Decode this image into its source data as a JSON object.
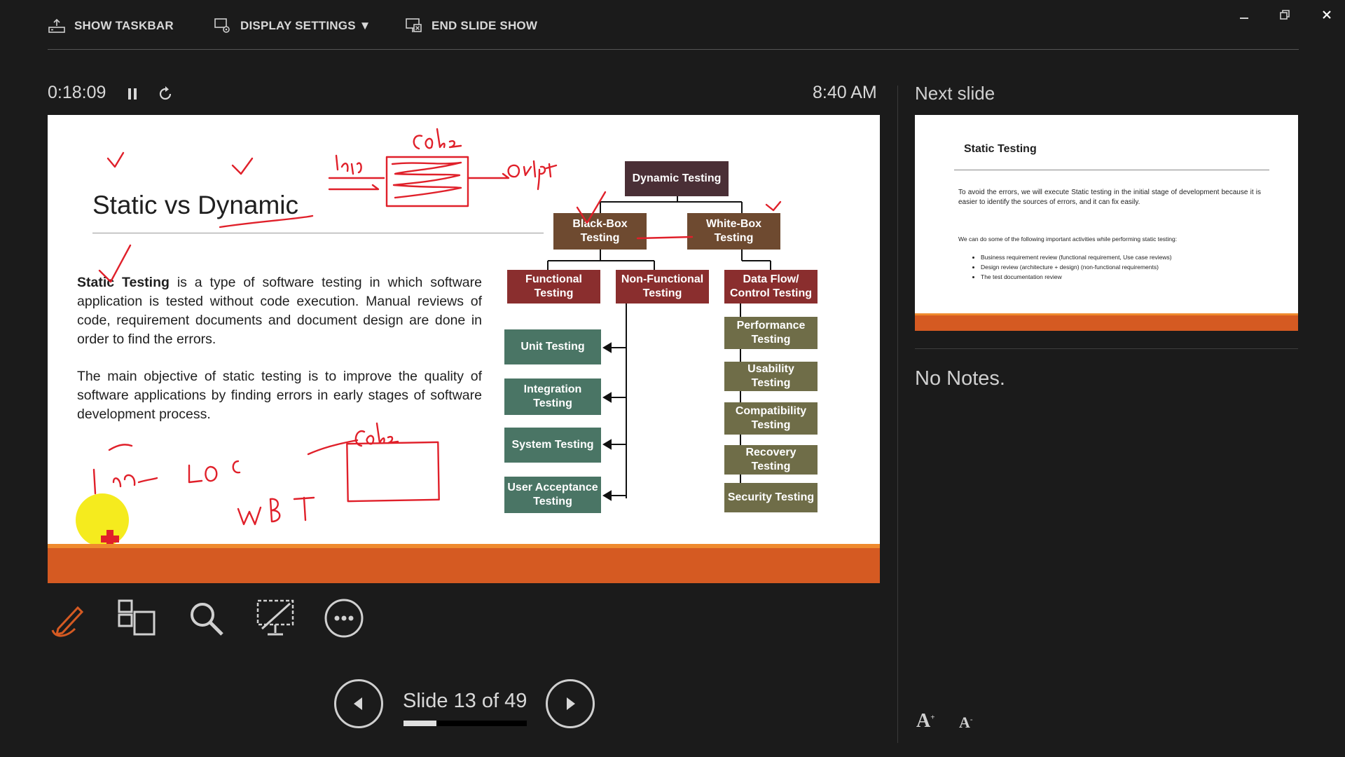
{
  "topbar": {
    "show_taskbar": "SHOW TASKBAR",
    "display_settings": "DISPLAY SETTINGS ▼",
    "end_slide_show": "END SLIDE SHOW"
  },
  "presenter": {
    "elapsed_time": "0:18:09",
    "clock": "8:40 AM",
    "next_slide_label": "Next slide",
    "notes": "No Notes.",
    "slide_counter": "Slide 13 of 49",
    "progress_fraction": 0.265
  },
  "slide": {
    "title": "Static vs Dynamic",
    "para1_bold": "Static Testing",
    "para1_rest": " is a type of software testing in which software application is tested without code execution. Manual reviews of code, requirement documents and document design are done in order to find the errors.",
    "para2": "The main objective of static testing is to improve the quality of software applications by finding errors in early stages of software development process.",
    "diagram": {
      "root": "Dynamic Testing",
      "black_box": "Black-Box Testing",
      "white_box": "White-Box Testing",
      "functional": "Functional Testing",
      "non_functional": "Non-Functional Testing",
      "data_flow": "Data Flow/ Control Testing",
      "functional_children": [
        "Unit Testing",
        "Integration Testing",
        "System Testing",
        "User Acceptance Testing"
      ],
      "non_functional_children": [
        "Performance Testing",
        "Usability Testing",
        "Compatibility Testing",
        "Recovery Testing",
        "Security Testing"
      ]
    },
    "annotations": {
      "input": "Input",
      "code_top": "Code",
      "output": "Output",
      "code_bottom": "Code",
      "loc": "LOC",
      "wbt": "WBT"
    }
  },
  "next_slide": {
    "title": "Static Testing",
    "text1": "To avoid the errors, we will execute Static testing in the initial stage of development because it is easier to identify the sources of errors, and it can fix easily.",
    "text2": "We can do some of the following important activities while performing static testing:",
    "bullets": [
      "Business requirement review (functional requirement, Use case reviews)",
      "Design review (architecture + design) (non-functional requirements)",
      "The test documentation review"
    ]
  },
  "colors": {
    "accent_orange": "#d55a22",
    "ink_red": "#e0202a"
  }
}
